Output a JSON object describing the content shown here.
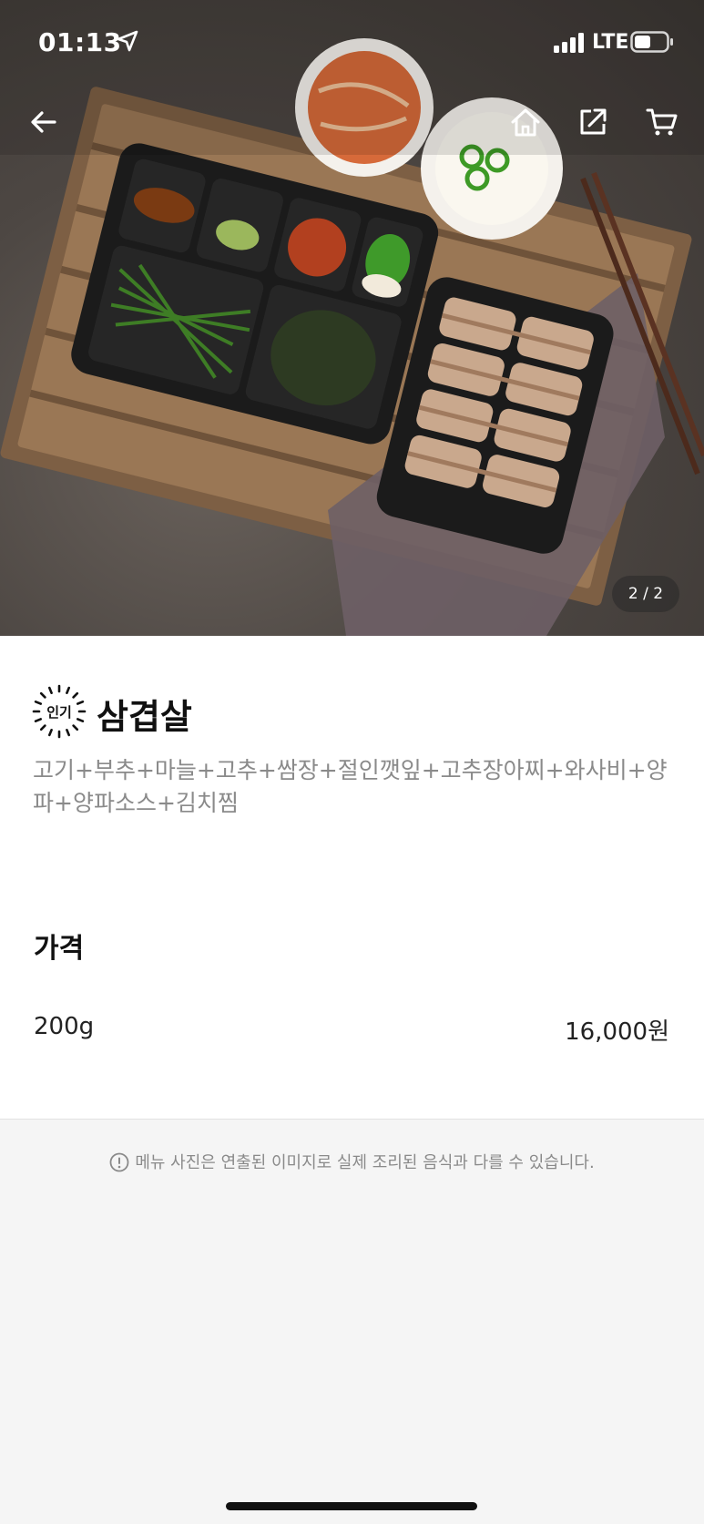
{
  "status_bar": {
    "time": "01:13",
    "network": "LTE"
  },
  "hero": {
    "page_indicator": "2 / 2",
    "current_page": 2,
    "total_pages": 2
  },
  "menu": {
    "badge": "인기",
    "title": "삼겹살",
    "description": "고기+부추+마늘+고추+쌈장+절인깻잎+고추장아찌+와사비+양파+양파소스+김치찜"
  },
  "price_section": {
    "heading": "가격",
    "options": [
      {
        "name": "200g",
        "price": "16,000원"
      }
    ]
  },
  "notice": {
    "text": "메뉴 사진은 연출된 이미지로 실제 조리된 음식과 다를 수 있습니다."
  },
  "colors": {
    "table": "#4d4743",
    "tray_wood": "#8a6a4c",
    "container": "#1b1b1b",
    "muted_text": "#8a8a8a",
    "background": "#f5f5f5"
  },
  "icons": [
    "location-arrow-icon",
    "signal-icon",
    "battery-icon",
    "back-arrow-icon",
    "home-icon",
    "share-icon",
    "cart-icon",
    "popular-badge-icon",
    "warning-icon"
  ]
}
